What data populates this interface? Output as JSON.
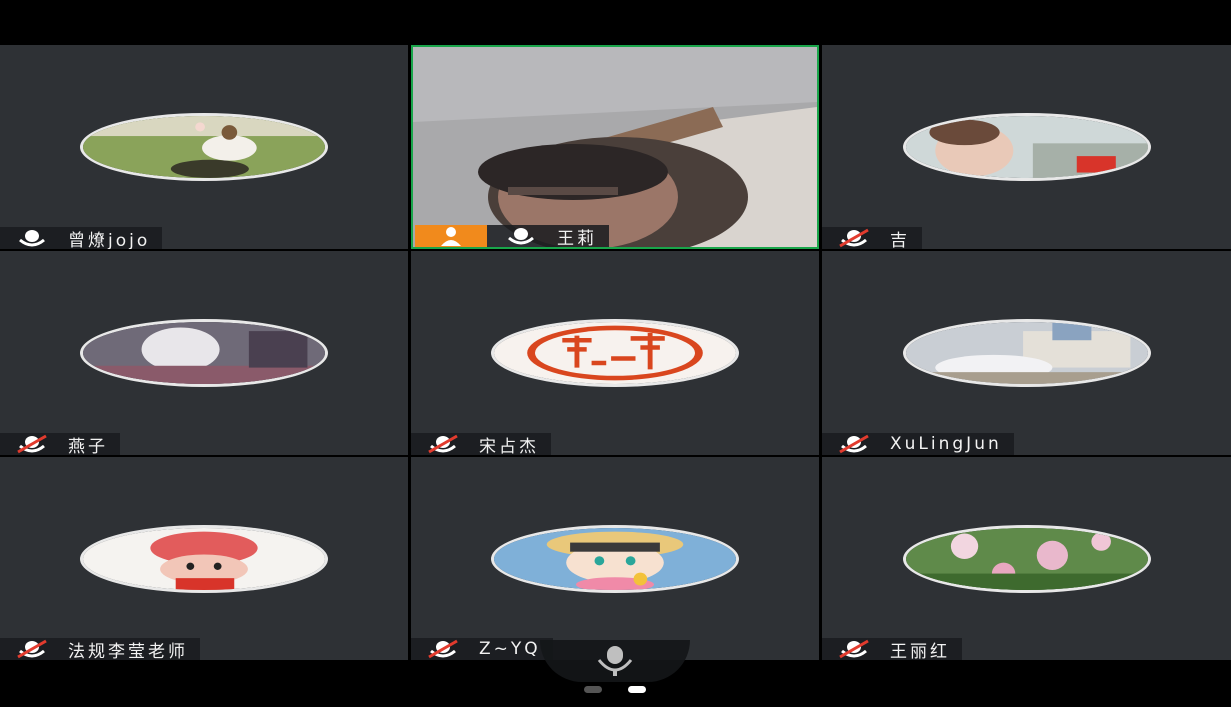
{
  "participants": [
    {
      "name": "曾燎jojo",
      "muted": false
    },
    {
      "name": "王莉",
      "muted": false,
      "host": true,
      "video_on": true
    },
    {
      "name": "吉",
      "muted": true
    },
    {
      "name": "燕子",
      "muted": true
    },
    {
      "name": "宋占杰",
      "muted": true
    },
    {
      "name": "XuLingJun",
      "muted": true
    },
    {
      "name": "法规李莹老师",
      "muted": true
    },
    {
      "name": "Z~YQ",
      "muted": true
    },
    {
      "name": "王丽红",
      "muted": true
    }
  ],
  "colors": {
    "tile_bg": "#2e3135",
    "active_border": "#19a54a",
    "host_badge": "#f18a1c",
    "muted_red": "#e23b2e"
  },
  "icons": {
    "mic": "mic-icon",
    "mic_muted": "mic-muted-icon",
    "host": "host-person-icon",
    "bottom_mic": "microphone-icon"
  },
  "pager": {
    "pages": 2,
    "current": 2
  }
}
